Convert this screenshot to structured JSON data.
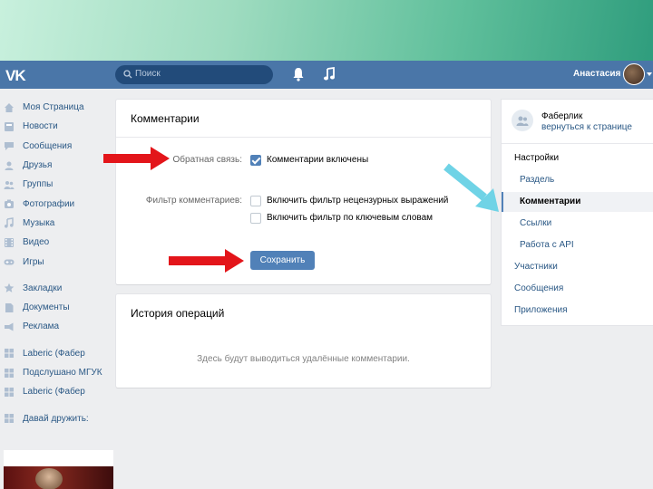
{
  "header": {
    "logo": "VK",
    "search_placeholder": "Поиск",
    "user_name": "Анастасия"
  },
  "leftnav": {
    "items": [
      {
        "label": "Моя Страница",
        "icon": "home-icon"
      },
      {
        "label": "Новости",
        "icon": "news-icon"
      },
      {
        "label": "Сообщения",
        "icon": "message-icon"
      },
      {
        "label": "Друзья",
        "icon": "friends-icon"
      },
      {
        "label": "Группы",
        "icon": "groups-icon"
      },
      {
        "label": "Фотографии",
        "icon": "camera-icon"
      },
      {
        "label": "Музыка",
        "icon": "music-icon"
      },
      {
        "label": "Видео",
        "icon": "video-icon"
      },
      {
        "label": "Игры",
        "icon": "gamepad-icon"
      }
    ],
    "items2": [
      {
        "label": "Закладки",
        "icon": "star-icon"
      },
      {
        "label": "Документы",
        "icon": "document-icon"
      },
      {
        "label": "Реклама",
        "icon": "ads-icon"
      }
    ],
    "items3": [
      {
        "label": "Laberic (Фабер",
        "icon": "group-icon"
      },
      {
        "label": "Подслушано МГУК",
        "icon": "group-icon"
      },
      {
        "label": "Laberic (Фабер",
        "icon": "group-icon"
      }
    ],
    "items4": [
      {
        "label": "Давай дружить:",
        "icon": "apps-icon"
      }
    ]
  },
  "comments_panel": {
    "title": "Комментарии",
    "feedback_label": "Обратная связь:",
    "feedback_option": "Комментарии включены",
    "feedback_checked": true,
    "filter_label": "Фильтр комментариев:",
    "filter_option1": "Включить фильтр нецензурных выражений",
    "filter_option2": "Включить фильтр по ключевым словам",
    "filter1_checked": false,
    "filter2_checked": false,
    "save_label": "Сохранить"
  },
  "history_panel": {
    "title": "История операций",
    "empty_text": "Здесь будут выводиться удалённые комментарии."
  },
  "rightmenu": {
    "community_name": "Фаберлик",
    "back_link": "вернуться к странице",
    "items": [
      {
        "label": "Настройки",
        "kind": "top"
      },
      {
        "label": "Раздель",
        "kind": "sub"
      },
      {
        "label": "Комментарии",
        "kind": "active"
      },
      {
        "label": "Ссылки",
        "kind": "sub"
      },
      {
        "label": "Работа с API",
        "kind": "sub"
      },
      {
        "label": "Участники",
        "kind": "top-link"
      },
      {
        "label": "Сообщения",
        "kind": "top-link"
      },
      {
        "label": "Приложения",
        "kind": "top-link"
      }
    ]
  },
  "colors": {
    "header": "#4a76a8",
    "button": "#5181b8",
    "link": "#2a5885",
    "red_arrow": "#e3151a",
    "cyan_arrow": "#6fd3e6"
  }
}
